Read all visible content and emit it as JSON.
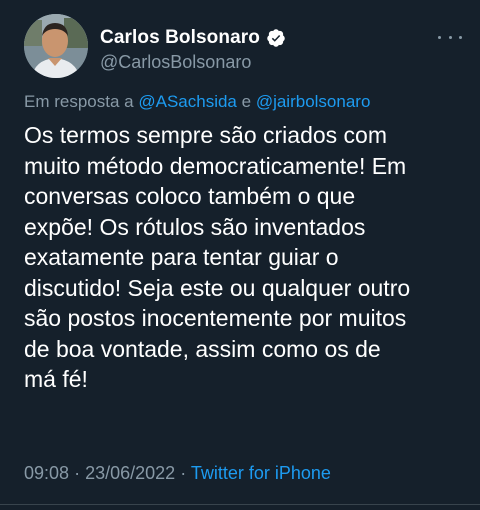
{
  "author": {
    "display_name": "Carlos Bolsonaro",
    "handle": "@CarlosBolsonaro",
    "verified": true
  },
  "reply": {
    "prefix": "Em resposta a",
    "mention1": "@ASachsida",
    "conjunction": "e",
    "mention2": "@jairbolsonaro"
  },
  "tweet": {
    "lines": [
      "Os termos sempre são criados com",
      "muito método democraticamente! Em",
      "conversas coloco também o que",
      "expõe! Os rótulos são inventados",
      "exatamente para tentar guiar o",
      "discutido! Seja este ou qualquer outro",
      "são postos inocentemente por muitos",
      "de boa vontade, assim como os de",
      "má fé!"
    ]
  },
  "meta": {
    "time": "09:08",
    "separator": "·",
    "date": "23/06/2022",
    "source": "Twitter for iPhone"
  },
  "icons": {
    "verified": "verified-badge-icon",
    "more": "more-options-icon"
  },
  "colors": {
    "background": "#15202b",
    "text_primary": "#ffffff",
    "text_secondary": "#8899a6",
    "accent": "#1d9bf0"
  }
}
